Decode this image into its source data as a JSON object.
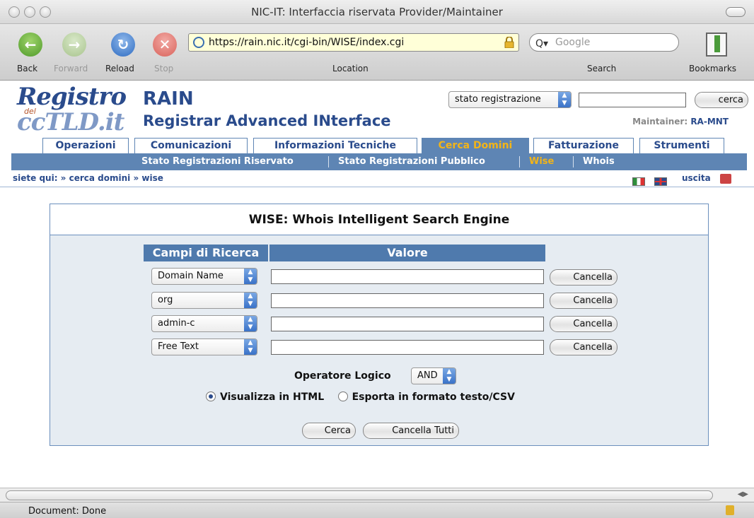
{
  "window": {
    "title": "NIC-IT: Interfaccia riservata Provider/Maintainer"
  },
  "toolbar": {
    "back_label": "Back",
    "forward_label": "Forward",
    "reload_label": "Reload",
    "stop_label": "Stop",
    "location_label": "Location",
    "search_label": "Search",
    "bookmarks_label": "Bookmarks",
    "url": "https://rain.nic.it/cgi-bin/WISE/index.cgi",
    "search_placeholder": "Google"
  },
  "header": {
    "logo_line1": "Registro",
    "logo_del": "del",
    "logo_line2": "ccTLD.it",
    "app_title": "RAIN",
    "app_subtitle": "Registrar Advanced INterface",
    "quick_search_select": "stato registrazione",
    "quick_search_button": "cerca",
    "maintainer_label": "Maintainer:",
    "maintainer_value": "RA-MNT"
  },
  "tabs": [
    {
      "label": "Operazioni"
    },
    {
      "label": "Comunicazioni"
    },
    {
      "label": "Informazioni Tecniche"
    },
    {
      "label": "Cerca Domini",
      "active": true
    },
    {
      "label": "Fatturazione"
    },
    {
      "label": "Strumenti"
    }
  ],
  "subnav": [
    {
      "label": "Stato Registrazioni Riservato"
    },
    {
      "label": "Stato Registrazioni Pubblico"
    },
    {
      "label": "Wise",
      "selected": true
    },
    {
      "label": "Whois"
    }
  ],
  "breadcrumb": "siete qui: » cerca domini » wise",
  "exit_label": "uscita",
  "wise": {
    "title": "WISE: Whois Intelligent Search Engine",
    "col_fields": "Campi di Ricerca",
    "col_value": "Valore",
    "rows": [
      {
        "field": "Domain Name",
        "value": "",
        "clear": "Cancella"
      },
      {
        "field": "org",
        "value": "",
        "clear": "Cancella"
      },
      {
        "field": "admin-c",
        "value": "",
        "clear": "Cancella"
      },
      {
        "field": "Free Text",
        "value": "",
        "clear": "Cancella"
      }
    ],
    "operator_label": "Operatore Logico",
    "operator_value": "AND",
    "radio_html": "Visualizza in HTML",
    "radio_csv": "Esporta in formato testo/CSV",
    "search_button": "Cerca",
    "clear_all_button": "Cancella Tutti"
  },
  "status": {
    "text": "Document: Done"
  },
  "colors": {
    "nav_blue": "#5e85b4",
    "title_blue": "#2a4b8c",
    "active_gold": "#f2b418"
  }
}
